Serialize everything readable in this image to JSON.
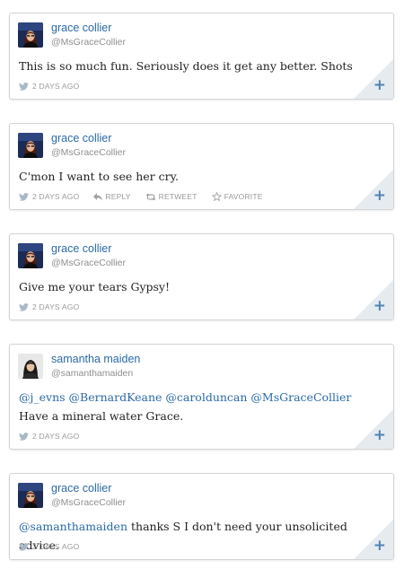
{
  "tweets": [
    {
      "name": "grace collier",
      "handle": "@MsGraceCollier",
      "segments": [
        {
          "text": "This is so much fun. Seriously does it get any better. Shots",
          "mention": false
        }
      ],
      "time": "2 DAYS AGO",
      "actions": [],
      "avatar_icon": "avatar-grace"
    },
    {
      "name": "grace collier",
      "handle": "@MsGraceCollier",
      "segments": [
        {
          "text": "C'mon I want to see her cry.",
          "mention": false
        }
      ],
      "time": "2 DAYS AGO",
      "actions": [
        {
          "label": "REPLY",
          "icon": "reply-icon"
        },
        {
          "label": "RETWEET",
          "icon": "retweet-icon"
        },
        {
          "label": "FAVORITE",
          "icon": "star-icon"
        }
      ],
      "avatar_icon": "avatar-grace"
    },
    {
      "name": "grace collier",
      "handle": "@MsGraceCollier",
      "segments": [
        {
          "text": "Give me your tears Gypsy!",
          "mention": false
        }
      ],
      "time": "2 DAYS AGO",
      "actions": [],
      "avatar_icon": "avatar-grace"
    },
    {
      "name": "samantha maiden",
      "handle": "@samanthamaiden",
      "segments": [
        {
          "text": "@j_evns",
          "mention": true
        },
        {
          "text": " ",
          "mention": false
        },
        {
          "text": "@BernardKeane",
          "mention": true
        },
        {
          "text": " ",
          "mention": false
        },
        {
          "text": "@carolduncan",
          "mention": true
        },
        {
          "text": " ",
          "mention": false
        },
        {
          "text": "@MsGraceCollier",
          "mention": true
        },
        {
          "text": " Have a mineral water Grace.",
          "mention": false
        }
      ],
      "time": "2 DAYS AGO",
      "actions": [],
      "avatar_icon": "avatar-samantha"
    },
    {
      "name": "grace collier",
      "handle": "@MsGraceCollier",
      "segments": [
        {
          "text": "@samanthamaiden",
          "mention": true
        },
        {
          "text": " thanks S I don't need your unsolicited advice.",
          "mention": false
        }
      ],
      "time": "2 DAYS AGO",
      "actions": [],
      "avatar_icon": "avatar-grace"
    }
  ],
  "colors": {
    "link": "#2b6aa8",
    "corner": "#e6ebf0",
    "plus": "#4f83b3"
  }
}
